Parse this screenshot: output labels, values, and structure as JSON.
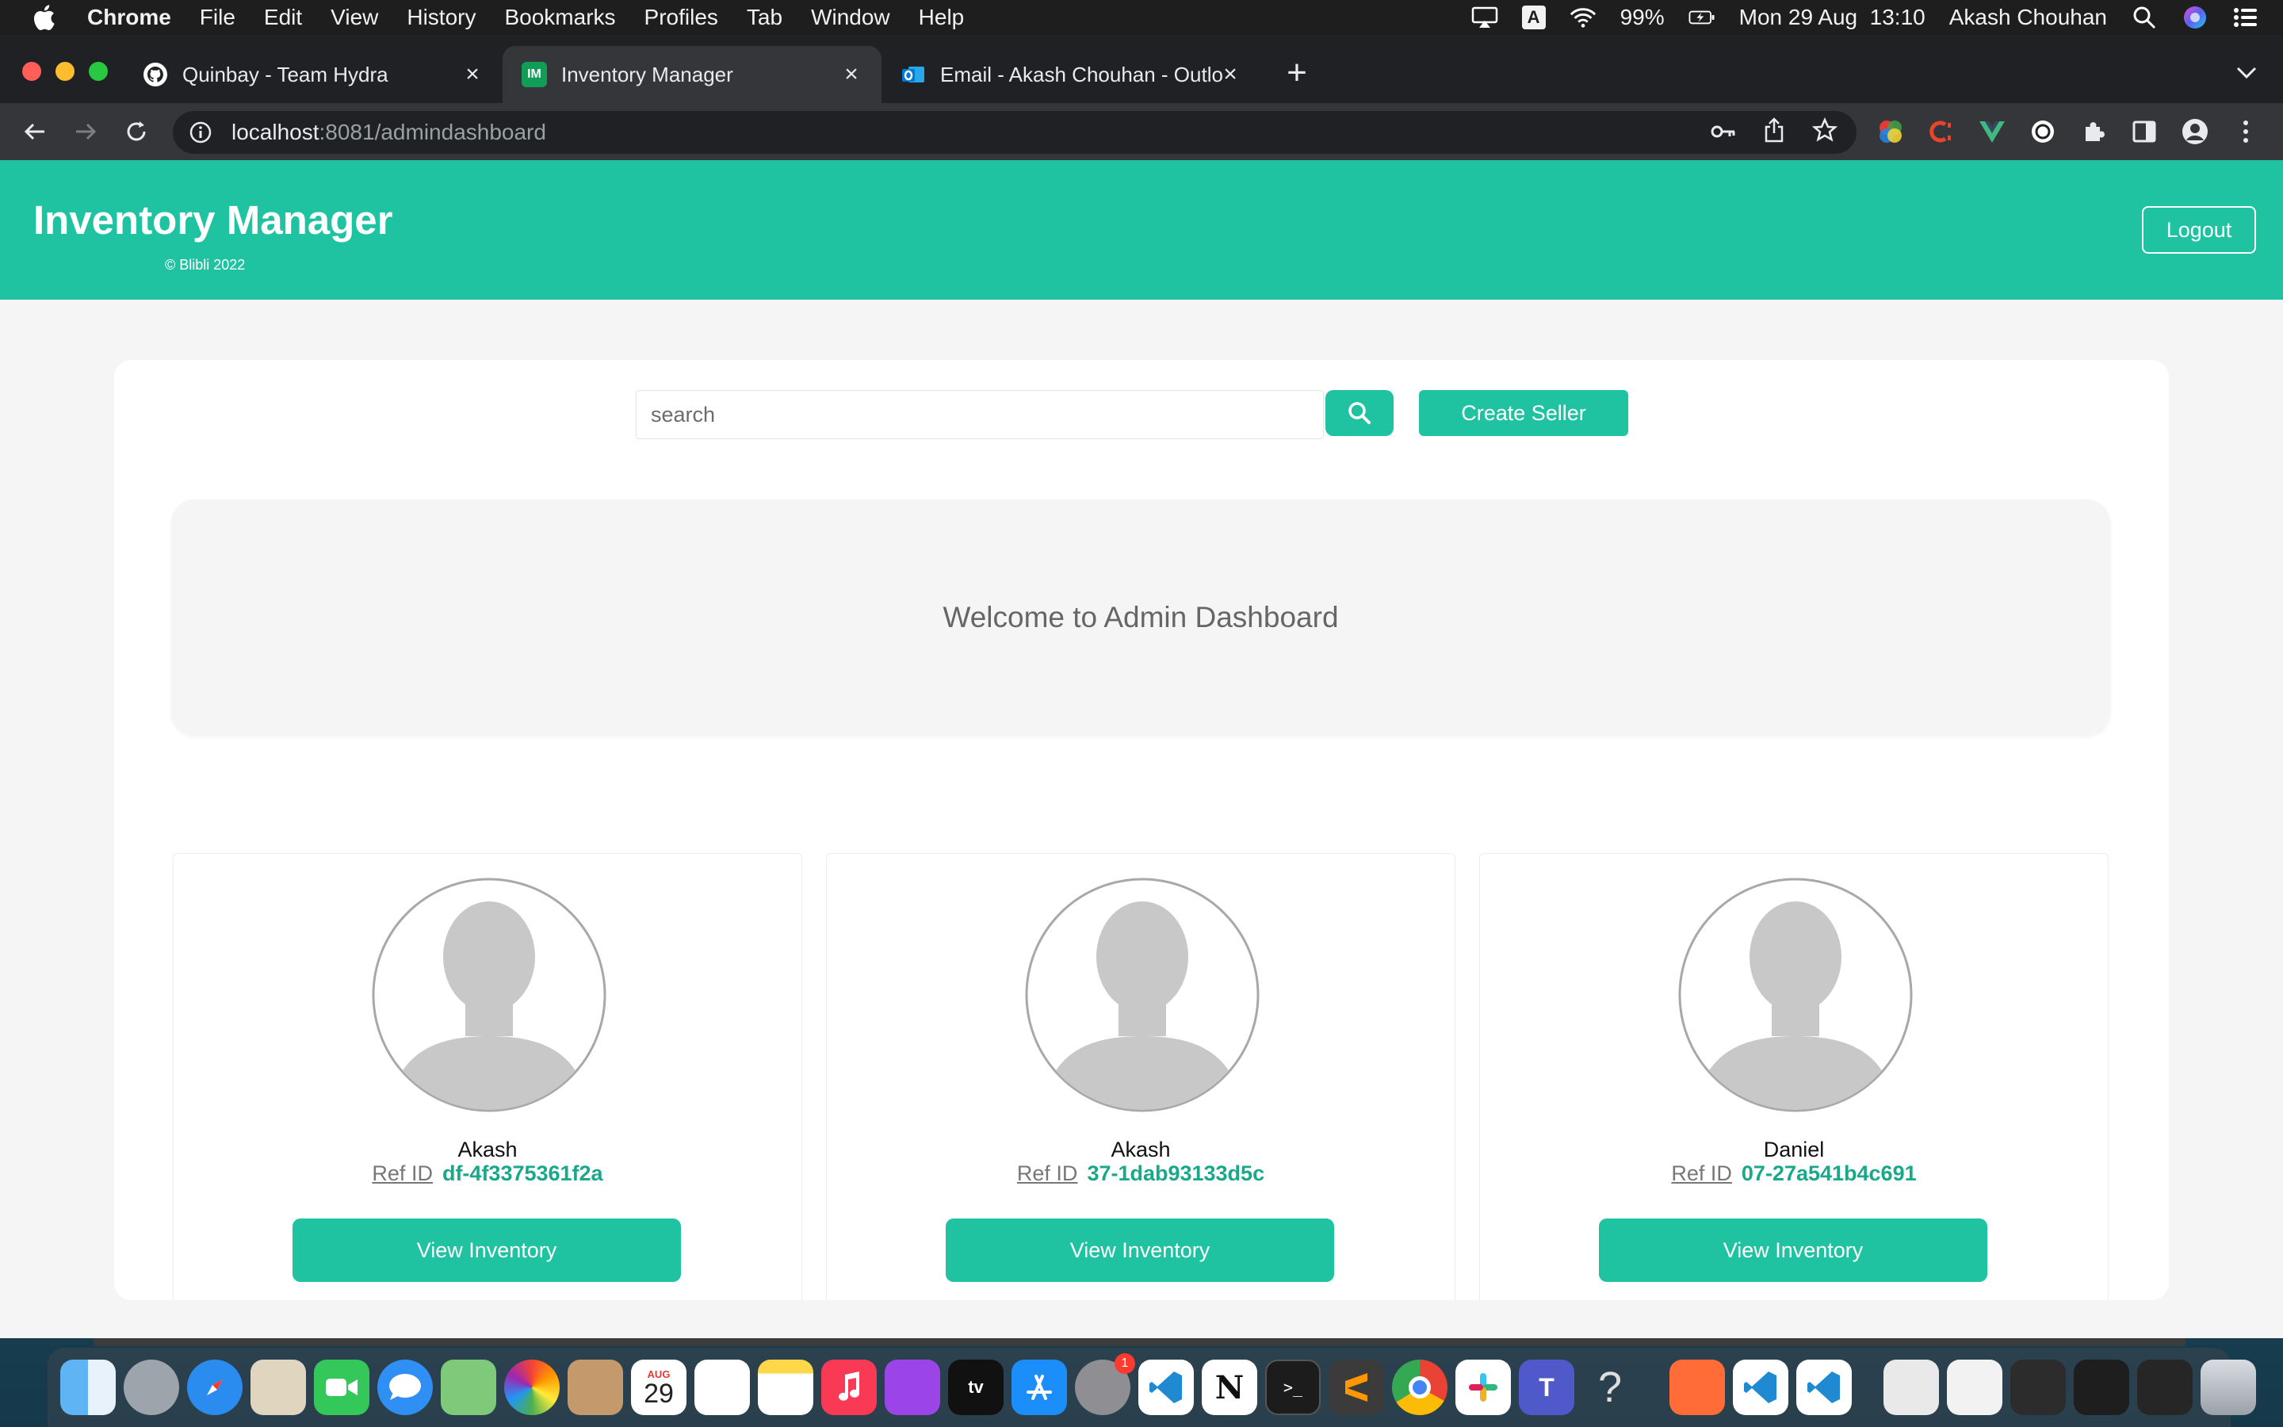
{
  "menubar": {
    "app": "Chrome",
    "items": [
      "File",
      "Edit",
      "View",
      "History",
      "Bookmarks",
      "Profiles",
      "Tab",
      "Window",
      "Help"
    ],
    "battery": "99%",
    "datetime": "Mon 29 Aug  13:10",
    "user": "Akash Chouhan",
    "input_source": "A"
  },
  "tabs": [
    {
      "label": "Quinbay - Team Hydra",
      "icon": "github-icon",
      "active": false
    },
    {
      "label": "Inventory Manager",
      "icon": "im-favicon",
      "favicon_text": "IM",
      "active": true
    },
    {
      "label": "Email - Akash Chouhan - Outlo",
      "icon": "outlook-icon",
      "active": false
    }
  ],
  "address_bar": {
    "host": "localhost",
    "path": ":8081/admindashboard"
  },
  "app": {
    "title": "Inventory Manager",
    "copyright": "© Blibli 2022",
    "logout_label": "Logout",
    "accent_color": "#20c3a1"
  },
  "toolbar": {
    "search_placeholder": "search",
    "create_label": "Create Seller"
  },
  "welcome_text": "Welcome to Admin Dashboard",
  "sellers": [
    {
      "name": "Akash",
      "ref_label": "Ref ID",
      "ref_id": "df-4f3375361f2a",
      "button_label": "View Inventory"
    },
    {
      "name": "Akash",
      "ref_label": "Ref ID",
      "ref_id": "37-1dab93133d5c",
      "button_label": "View Inventory"
    },
    {
      "name": "Daniel",
      "ref_label": "Ref ID",
      "ref_id": "07-27a541b4c691",
      "button_label": "View Inventory"
    }
  ],
  "dock": {
    "calendar_month": "AUG",
    "calendar_day": "29",
    "settings_badge": "1",
    "apps": [
      "finder-icon",
      "launchpad-icon",
      "safari-icon",
      "mail-icon",
      "facetime-icon",
      "messages-icon",
      "maps-icon",
      "photos-icon",
      "contacts-icon",
      "calendar-icon",
      "reminders-icon",
      "notes-icon",
      "music-icon",
      "podcasts-icon",
      "tv-icon",
      "app-store-icon",
      "system-preferences-icon",
      "vscode-icon",
      "notion-icon",
      "terminal-icon",
      "sublime-text-icon",
      "chrome-icon",
      "slack-icon",
      "teams-icon",
      "help-icon",
      "postman-icon",
      "vscode-icon-2",
      "vscode-icon-3",
      "archive-icon",
      "window-thumbnail-icon",
      "terminal-thumbnail-icon",
      "terminal-thumbnail-icon-2",
      "terminal-thumbnail-icon-3",
      "trash-icon"
    ]
  }
}
